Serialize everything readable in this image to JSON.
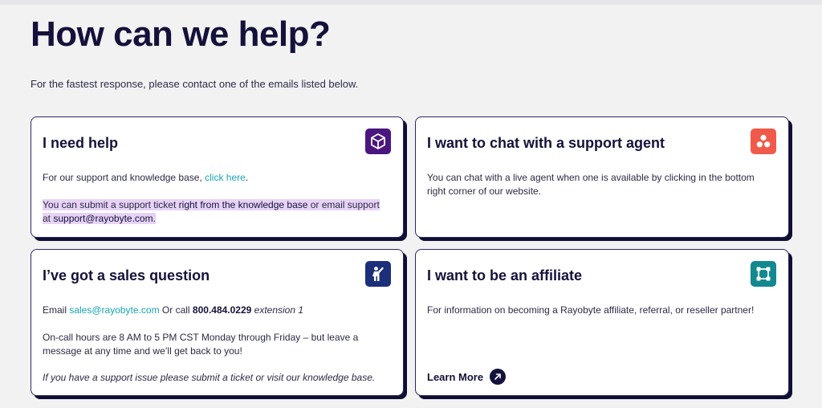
{
  "page": {
    "title": "How can we help?",
    "subtitle": "For the fastest response, please contact one of the emails listed below."
  },
  "cards": {
    "help": {
      "title": "I need help",
      "icon": "cube-icon",
      "icon_color": "#4b1680",
      "line1_prefix": "For our support and knowledge base, ",
      "line1_link": "click here",
      "line1_suffix": ".",
      "line2_a": "You can submit a support ticket ",
      "line2_b": "right from the knowledge base",
      "line2_c": " or email support at ",
      "line2_email": "support@rayobyte.com",
      "line2_end": "."
    },
    "chat": {
      "title": "I want to chat with a support agent",
      "icon": "people-circles-icon",
      "icon_color": "#f15a4a",
      "text": "You can chat with a live agent when one is available by clicking in the bottom right corner of our website."
    },
    "sales": {
      "title": "I’ve got a sales question",
      "icon": "person-raising-hand-icon",
      "icon_color": "#1b2f7a",
      "email_label": "Email ",
      "email": "sales@rayobyte.com",
      "call_label": " Or call ",
      "phone": "800.484.0229",
      "extension": " extension 1",
      "hours": "On-call hours are 8 AM to 5 PM CST Monday through Friday – but leave a message at any time and we’ll get back to you!",
      "note": "If you have a support issue please submit a ticket or visit our knowledge base."
    },
    "affiliate": {
      "title": "I want to be an affiliate",
      "icon": "network-nodes-icon",
      "icon_color": "#12888f",
      "text": "For information on becoming a Rayobyte affiliate, referral, or reseller partner!",
      "cta": "Learn More",
      "cta_icon": "arrow-up-right-icon"
    }
  }
}
